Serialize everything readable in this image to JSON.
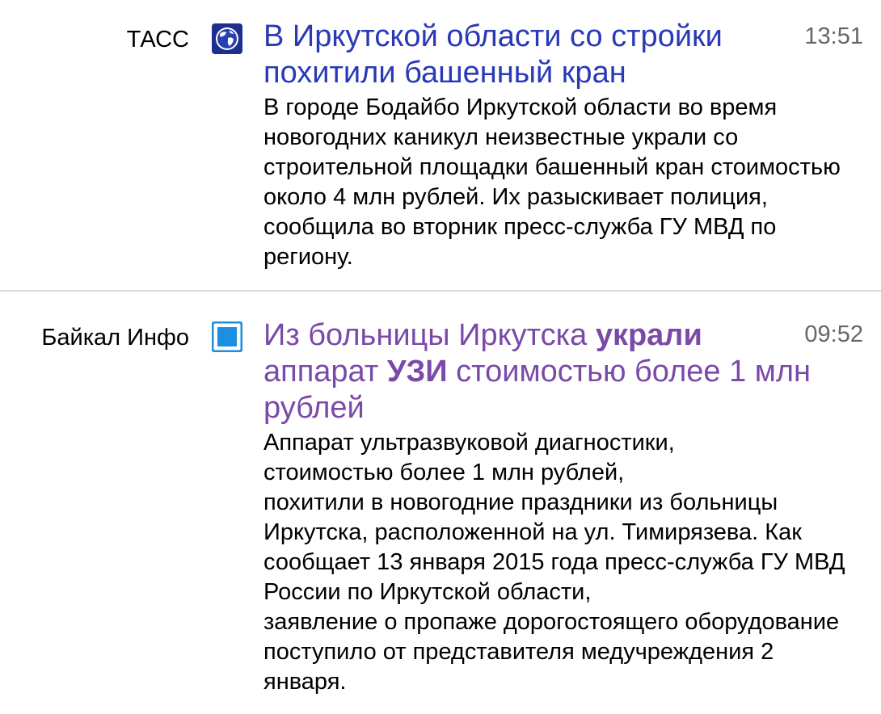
{
  "items": [
    {
      "source": "ТАСС",
      "favicon": "globe-icon",
      "title_parts": [
        "В Иркутской области со стройки похитили башенный кран"
      ],
      "title_color": "#2a39b8",
      "time": "13:51",
      "snippet": [
        "В городе Бодайбо Иркутской области во время новогодних каникул неизвестные украли со строительной площадки башенный кран стоимостью около 4 млн рублей. Их разыскивает полиция, сообщила во вторник пресс-служба ГУ МВД по региону."
      ]
    },
    {
      "source": "Байкал Инфо",
      "favicon": "blue-square-icon",
      "title_parts": [
        "Из больницы Иркутска ",
        "украли",
        "аппарат ",
        "УЗИ",
        " стоимостью более 1 млн рублей"
      ],
      "title_color": "#7a4aa8",
      "time": "09:52",
      "snippet": [
        "Аппарат ультразвуковой диагностики,",
        "стоимостью более 1 млн рублей,",
        "похитили в новогодние праздники из больницы Иркутска, расположенной на ул. Тимирязева. Как сообщает 13 января 2015 года пресс-служба ГУ МВД России по Иркутской области,",
        "заявление о пропаже дорогостоящего оборудование поступило от представителя медучреждения 2 января."
      ]
    }
  ]
}
